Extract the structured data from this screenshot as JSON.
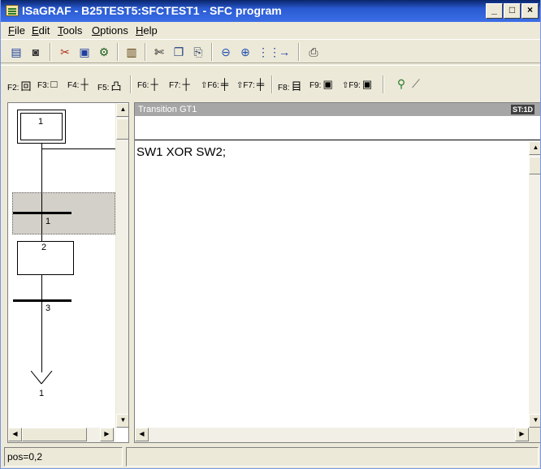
{
  "window": {
    "title": "ISaGRAF - B25TEST5:SFCTEST1 - SFC program",
    "min_label": "_",
    "max_label": "□",
    "close_label": "×"
  },
  "menu": [
    "File",
    "Edit",
    "Tools",
    "Options",
    "Help"
  ],
  "toolbar1": {
    "icons": [
      "open-file-icon",
      "save-icon",
      "cut-all-icon",
      "monitor-icon",
      "tools-icon",
      "library-icon",
      "scissors-icon",
      "copy-icon",
      "paste-icon",
      "zoom-out-icon",
      "zoom-in-icon",
      "grid-icon",
      "arrow-right-icon",
      "print-icon"
    ]
  },
  "toolbar2": {
    "keys": [
      {
        "key": "F2:",
        "glyph": "回"
      },
      {
        "key": "F3:",
        "glyph": "□"
      },
      {
        "key": "F4:",
        "glyph": "┼"
      },
      {
        "key": "F5:",
        "glyph": "凸"
      },
      {
        "key": "F6:",
        "glyph": "┼"
      },
      {
        "key": "F7:",
        "glyph": "┼"
      },
      {
        "key": "⇧F6:",
        "glyph": "╪"
      },
      {
        "key": "⇧F7:",
        "glyph": "╪"
      },
      {
        "key": "F8:",
        "glyph": "目"
      },
      {
        "key": "F9:",
        "glyph": "▣"
      },
      {
        "key": "⇧F9:",
        "glyph": "▣"
      }
    ]
  },
  "sfc": {
    "step_init": "1",
    "transition_1": "1",
    "step_2": "2",
    "transition_3": "3",
    "jump_target": "1"
  },
  "editor": {
    "header_title": "Transition GT1",
    "language_badge": "ST:1D",
    "code": "SW1 XOR SW2;"
  },
  "status": {
    "position": "pos=0,2",
    "extra": ""
  },
  "colors": {
    "titlebar": "#0a246a",
    "face": "#ece9d8",
    "selection": "#d2d0c8"
  }
}
